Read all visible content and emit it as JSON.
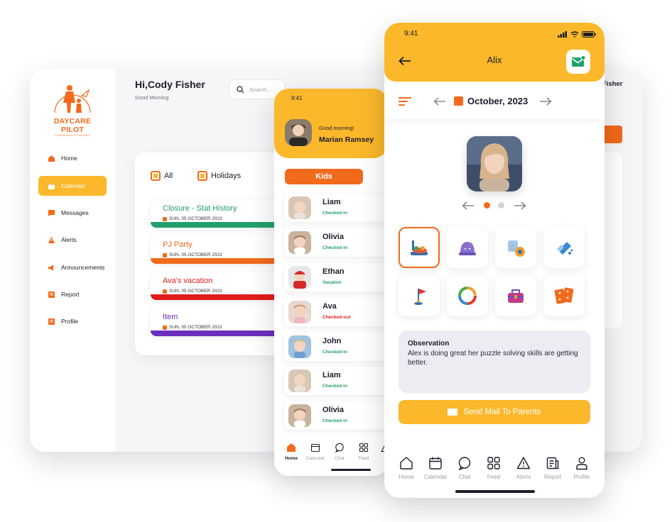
{
  "colors": {
    "orange": "#f26a1b",
    "yellow": "#fbb82a",
    "green": "#22a06b",
    "red": "#e21b1b",
    "purple": "#6b2fbf"
  },
  "desktop": {
    "brand": {
      "name": "DAYCARE PILOT",
      "tagline": "LEARN WHILE PLAYING"
    },
    "greeting": {
      "title": "Hi,Cody Fisher",
      "subtitle": "Good Morning"
    },
    "search_placeholder": "Search...",
    "user_right": "Fisher",
    "nav": [
      {
        "label": "Home",
        "icon": "home-icon"
      },
      {
        "label": "Calendar",
        "icon": "calendar-icon",
        "active": true
      },
      {
        "label": "Messages",
        "icon": "messages-icon"
      },
      {
        "label": "Alerts",
        "icon": "alert-icon"
      },
      {
        "label": "Announcements",
        "icon": "megaphone-icon"
      },
      {
        "label": "Report",
        "icon": "report-icon"
      },
      {
        "label": "Profile",
        "icon": "profile-icon"
      }
    ],
    "filters": [
      "All",
      "Holidays"
    ],
    "events": [
      {
        "title": "Closure - Stat History",
        "date": "SUN, 05 OCTOBER 2023",
        "color": "#22a06b"
      },
      {
        "title": "PJ Party",
        "date": "SUN, 05 OCTOBER 2023",
        "color": "#f26a1b"
      },
      {
        "title": "Ava's vacation",
        "date": "SUN, 05 OCTOBER 2023",
        "color": "#e21b1b"
      },
      {
        "title": "Item",
        "date": "SUN, 05 OCTOBER 2023",
        "color": "#6b2fbf"
      }
    ]
  },
  "phone_kids": {
    "time": "9:41",
    "greeting": "Good morning!",
    "name": "Marian Ramsey",
    "tab_label": "Kids",
    "kids": [
      {
        "name": "Liam",
        "status": "Checked-in",
        "status_color": "#22a06b"
      },
      {
        "name": "Olivia",
        "status": "Checked-in",
        "status_color": "#22a06b"
      },
      {
        "name": "Ethan",
        "status": "Vacation",
        "status_color": "#22a06b"
      },
      {
        "name": "Ava",
        "status": "Checked-out",
        "status_color": "#e21b1b"
      },
      {
        "name": "John",
        "status": "Checked-in",
        "status_color": "#22a06b"
      },
      {
        "name": "Liam",
        "status": "Checked-in",
        "status_color": "#22a06b"
      },
      {
        "name": "Olivia",
        "status": "Checked-in",
        "status_color": "#22a06b"
      }
    ],
    "tabs": [
      "Home",
      "Calendar",
      "Chat",
      "Feed",
      "A"
    ]
  },
  "phone_child": {
    "time": "9:41",
    "title": "Alix",
    "month": "October, 2023",
    "activities": [
      "meal-icon",
      "nap-icon",
      "potty-icon",
      "diaper-icon",
      "mini-golf-icon",
      "activity-ring-icon",
      "toolbox-icon",
      "dice-game-icon"
    ],
    "observation": {
      "title": "Observation",
      "body": "Alex is doing great her puzzle solving skills are getting better."
    },
    "send_button": "Send Mail To Parents",
    "tabs": [
      "Home",
      "Calendar",
      "Chat",
      "Feed",
      "Alerts",
      "Report",
      "Profile"
    ]
  }
}
